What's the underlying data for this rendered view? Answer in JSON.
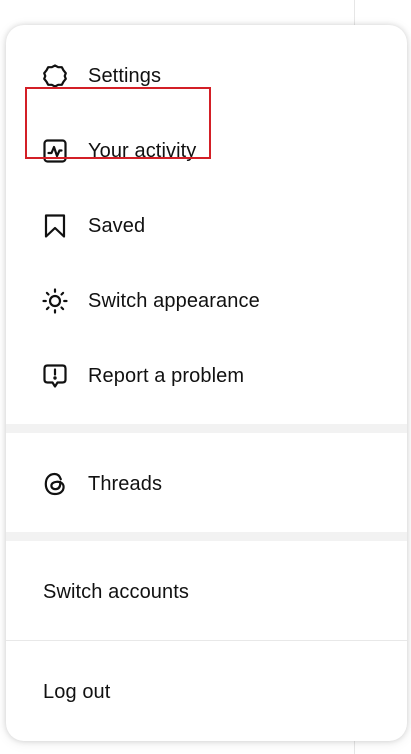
{
  "menu": {
    "items": [
      {
        "label": "Settings",
        "icon": "gear-icon"
      },
      {
        "label": "Your activity",
        "icon": "activity-icon"
      },
      {
        "label": "Saved",
        "icon": "bookmark-icon"
      },
      {
        "label": "Switch appearance",
        "icon": "sun-icon"
      },
      {
        "label": "Report a problem",
        "icon": "report-icon"
      }
    ],
    "threads": {
      "label": "Threads",
      "icon": "threads-icon"
    },
    "switch_accounts": {
      "label": "Switch accounts"
    },
    "log_out": {
      "label": "Log out"
    }
  },
  "highlight_color": "#d31f26"
}
